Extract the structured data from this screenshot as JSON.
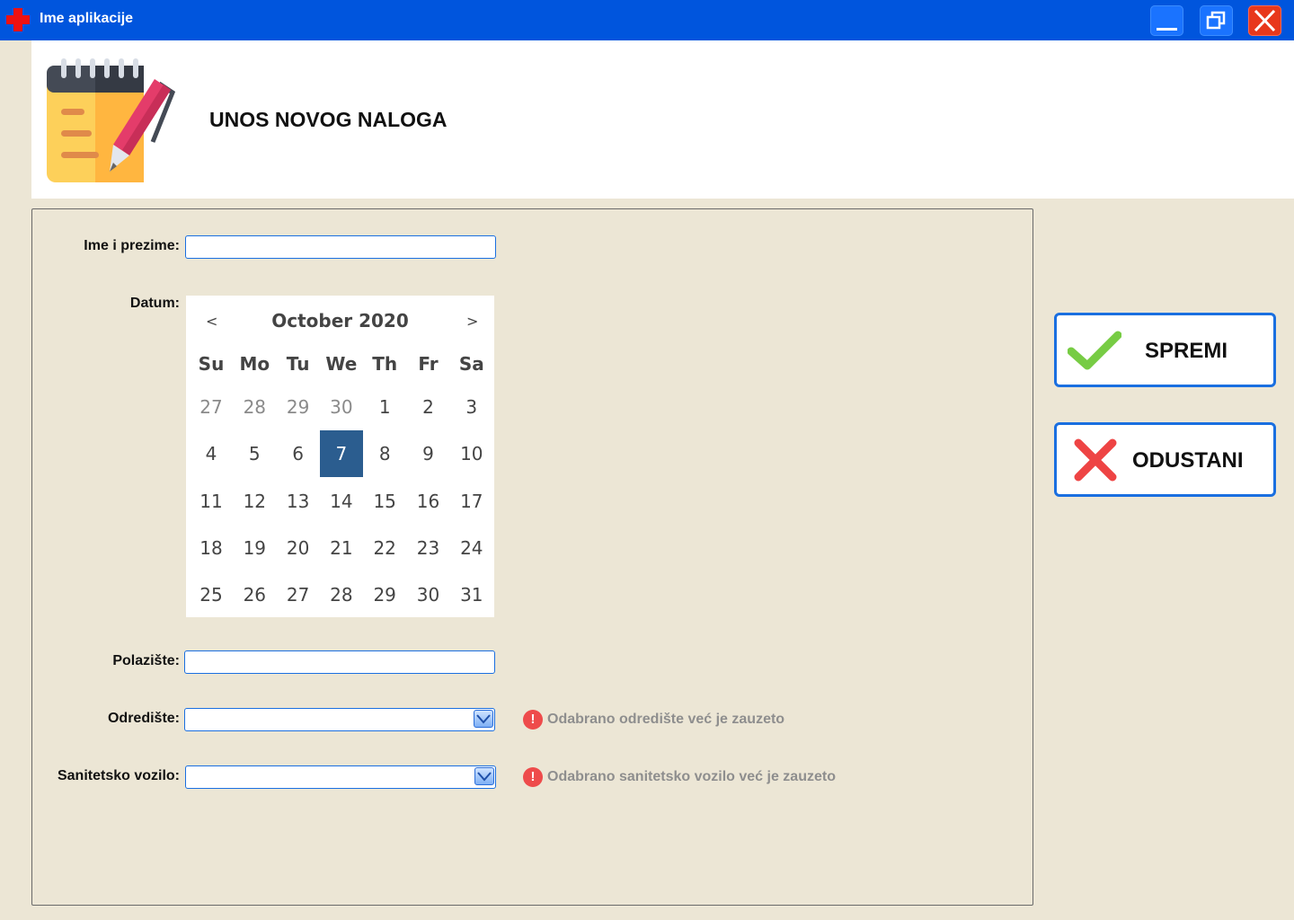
{
  "window": {
    "title": "Ime aplikacije",
    "icon": "red-cross-icon",
    "controls": [
      "minimize-icon",
      "restore-icon",
      "close-icon"
    ],
    "title_bar_color": "#0055dd"
  },
  "header": {
    "title": "UNOS NOVOG NALOGA",
    "icon": "notepad-pen-icon"
  },
  "form": {
    "name": {
      "label": "Ime i prezime:",
      "value": ""
    },
    "date": {
      "label": "Datum:",
      "calendar": {
        "prev": "<",
        "next": ">",
        "month": "October 2020",
        "weekdays": [
          "Su",
          "Mo",
          "Tu",
          "We",
          "Th",
          "Fr",
          "Sa"
        ],
        "weeks": [
          [
            "27",
            "28",
            "29",
            "30",
            "1",
            "2",
            "3"
          ],
          [
            "4",
            "5",
            "6",
            "7",
            "8",
            "9",
            "10"
          ],
          [
            "11",
            "12",
            "13",
            "14",
            "15",
            "16",
            "17"
          ],
          [
            "18",
            "19",
            "20",
            "21",
            "22",
            "23",
            "24"
          ],
          [
            "25",
            "26",
            "27",
            "28",
            "29",
            "30",
            "31"
          ]
        ],
        "selected_day": "7",
        "selected_color": "#2b5d8f"
      }
    },
    "origin": {
      "label": "Polazište:",
      "value": ""
    },
    "destination": {
      "label": "Odredište:",
      "value": "",
      "warning": "Odabrano odredište već je zauzeto"
    },
    "vehicle": {
      "label": "Sanitetsko vozilo:",
      "value": "",
      "warning": "Odabrano sanitetsko vozilo već je zauzeto"
    }
  },
  "actions": {
    "save": {
      "label": "SPREMI",
      "icon": "checkmark-icon",
      "color": "#77cc44"
    },
    "cancel": {
      "label": "ODUSTANI",
      "icon": "x-cross-icon",
      "color": "#ee4444"
    }
  }
}
